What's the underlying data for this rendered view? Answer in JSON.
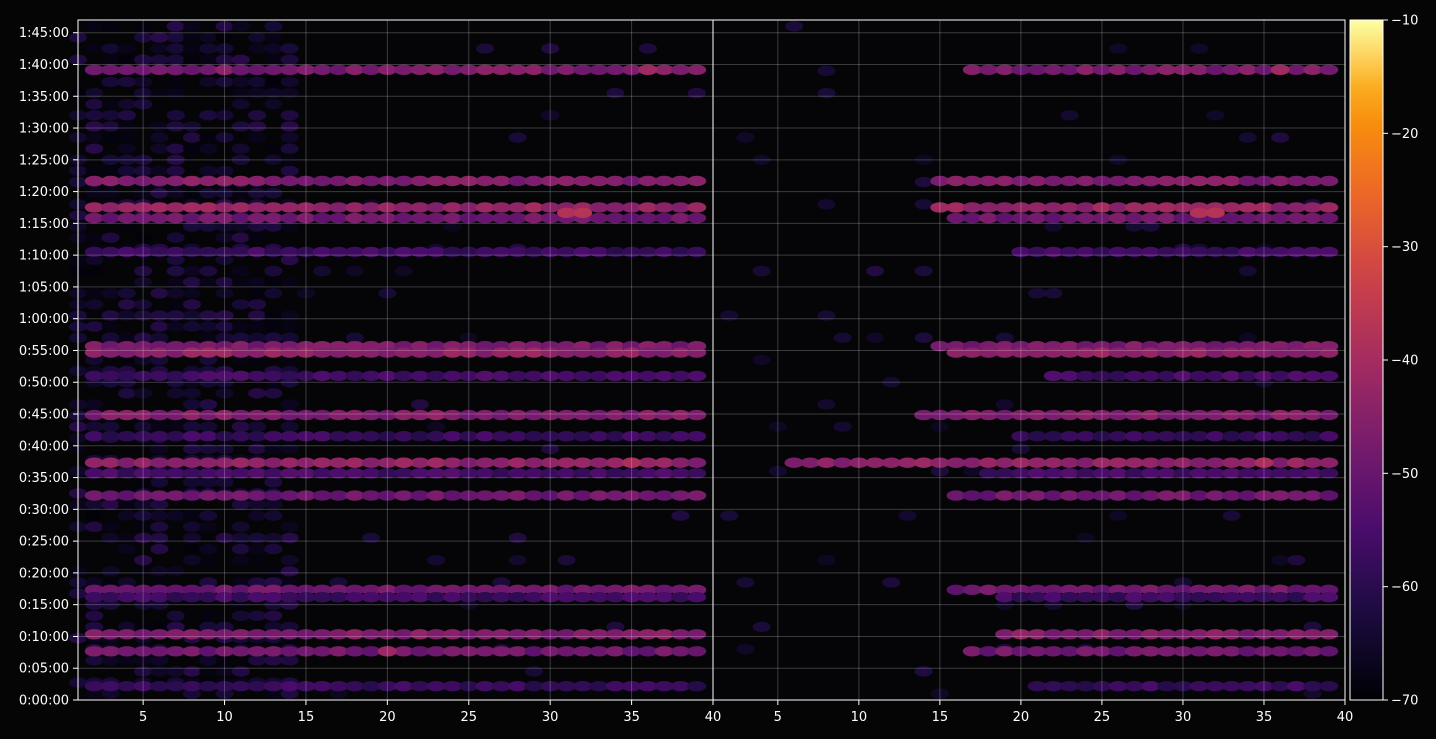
{
  "chart_data": {
    "type": "heatmap",
    "title": "",
    "xlabel": "",
    "ylabel": "",
    "grid": true,
    "colormap": "inferno",
    "background_color": "#050508",
    "panels": [
      {
        "name": "left",
        "xlim": [
          1,
          40
        ],
        "x_ticks": [
          5,
          10,
          15,
          20,
          25,
          30,
          35,
          40
        ],
        "x_tick_labels": [
          "5",
          "10",
          "15",
          "20",
          "25",
          "30",
          "35",
          "40"
        ],
        "noise_cols": [
          1,
          14
        ]
      },
      {
        "name": "right",
        "xlim": [
          1,
          40
        ],
        "x_ticks": [
          5,
          10,
          15,
          20,
          25,
          30,
          35,
          40
        ],
        "x_tick_labels": [
          "5",
          "10",
          "15",
          "20",
          "25",
          "30",
          "35",
          "40"
        ],
        "noise_cols": [
          0,
          0
        ]
      }
    ],
    "ylim_seconds": [
      0,
      6420
    ],
    "y_ticks_seconds": [
      0,
      300,
      600,
      900,
      1200,
      1500,
      1800,
      2100,
      2400,
      2700,
      3000,
      3300,
      3600,
      3900,
      4200,
      4500,
      4800,
      5100,
      5400,
      5700,
      6000,
      6300
    ],
    "y_tick_labels": [
      "0:00:00",
      "0:05:00",
      "0:10:00",
      "0:15:00",
      "0:20:00",
      "0:25:00",
      "0:30:00",
      "0:35:00",
      "0:40:00",
      "0:45:00",
      "0:50:00",
      "0:55:00",
      "1:00:00",
      "1:05:00",
      "1:10:00",
      "1:15:00",
      "1:20:00",
      "1:25:00",
      "1:30:00",
      "1:35:00",
      "1:40:00",
      "1:45:00"
    ],
    "rows": [
      {
        "t": 5950,
        "value": -47,
        "right_start": 17
      },
      {
        "t": 4900,
        "value": -46,
        "right_start": 15
      },
      {
        "t": 4650,
        "value": -43,
        "right_start": 15
      },
      {
        "t": 4550,
        "value": -49,
        "right_start": 16
      },
      {
        "t": 4230,
        "value": -57,
        "right_start": 20
      },
      {
        "t": 3340,
        "value": -47,
        "right_start": 15
      },
      {
        "t": 3280,
        "value": -44,
        "right_start": 16
      },
      {
        "t": 3060,
        "value": -56,
        "right_start": 22
      },
      {
        "t": 2690,
        "value": -46,
        "right_start": 14
      },
      {
        "t": 2490,
        "value": -58,
        "right_start": 20
      },
      {
        "t": 2240,
        "value": -44,
        "right_start": 6
      },
      {
        "t": 2140,
        "value": -56,
        "right_start": 18
      },
      {
        "t": 1930,
        "value": -49,
        "right_start": 16
      },
      {
        "t": 1040,
        "value": -49,
        "right_start": 16
      },
      {
        "t": 970,
        "value": -57,
        "right_start": 19
      },
      {
        "t": 620,
        "value": -46,
        "right_start": 19
      },
      {
        "t": 460,
        "value": -49,
        "right_start": 17
      },
      {
        "t": 130,
        "value": -58,
        "right_start": 21
      }
    ],
    "hotspots": [
      {
        "panel": "left",
        "x": 31,
        "t": 4600,
        "value": -38
      },
      {
        "panel": "left",
        "x": 32,
        "t": 4600,
        "value": -37
      },
      {
        "panel": "left",
        "x": 35,
        "t": 2240,
        "value": -39
      },
      {
        "panel": "left",
        "x": 36,
        "t": 5950,
        "value": -41
      },
      {
        "panel": "left",
        "x": 20,
        "t": 460,
        "value": -42
      },
      {
        "panel": "left",
        "x": 21,
        "t": 2240,
        "value": -41
      },
      {
        "panel": "right",
        "x": 31,
        "t": 4600,
        "value": -38
      },
      {
        "panel": "right",
        "x": 32,
        "t": 4600,
        "value": -37
      },
      {
        "panel": "right",
        "x": 35,
        "t": 2240,
        "value": -39
      },
      {
        "panel": "right",
        "x": 36,
        "t": 5950,
        "value": -41
      }
    ],
    "colorbar": {
      "min": -70,
      "max": -10,
      "ticks": [
        -70,
        -60,
        -50,
        -40,
        -30,
        -20,
        -10
      ],
      "tick_labels": [
        "−70",
        "−60",
        "−50",
        "−40",
        "−30",
        "−20",
        "−10"
      ]
    }
  }
}
